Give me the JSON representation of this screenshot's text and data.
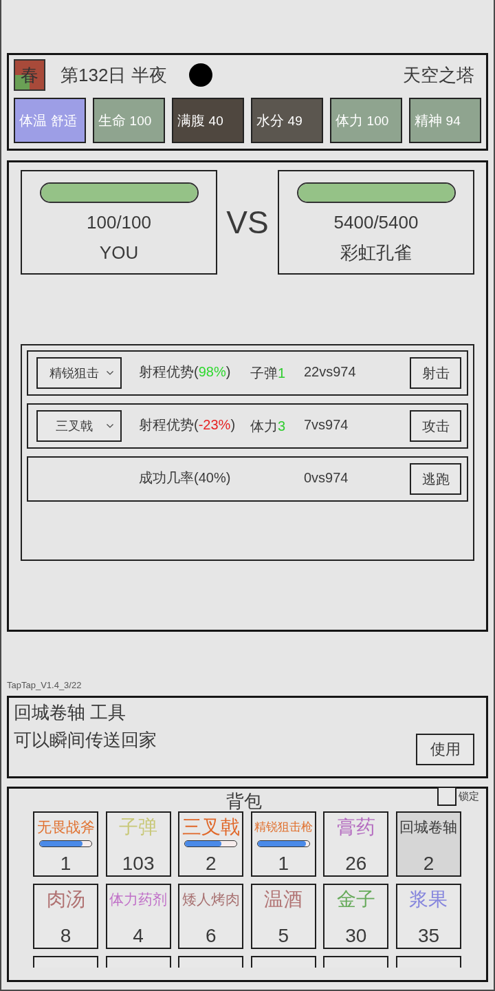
{
  "header": {
    "season": "春",
    "day": "第132日 半夜",
    "night": true,
    "location": "天空之塔",
    "stats": [
      {
        "label": "体温",
        "value": "舒适",
        "color": "#9d9ee6"
      },
      {
        "label": "生命",
        "value": "100",
        "color": "#8fa48f"
      },
      {
        "label": "满腹",
        "value": "40",
        "color": "#4f473f"
      },
      {
        "label": "水分",
        "value": "49",
        "color": "#5b564f"
      },
      {
        "label": "体力",
        "value": "100",
        "color": "#8fa48f"
      },
      {
        "label": "精神",
        "value": "94",
        "color": "#8fa48f"
      }
    ]
  },
  "battle": {
    "fighters": [
      {
        "hp": "100/100",
        "name": "YOU",
        "level": 1
      },
      {
        "hp": "5400/5400",
        "name": "彩虹孔雀",
        "level": 1
      }
    ],
    "versus": "VS",
    "actions": [
      {
        "kind": "weapon",
        "weapon": "精锐狙击",
        "stat": {
          "prefix": "射程优势(",
          "value": "98%",
          "suffix": ")",
          "color": "#2ed82e"
        },
        "cost_label": "子弹",
        "cost_value": "1",
        "power": "22vs974",
        "button": "射击"
      },
      {
        "kind": "weapon",
        "weapon": "三叉戟",
        "stat": {
          "prefix": "射程优势(",
          "value": "-23%",
          "suffix": ")",
          "color": "#e62222"
        },
        "cost_label": "体力",
        "cost_value": "3",
        "power": "7vs974",
        "button": "攻击"
      },
      {
        "kind": "flee",
        "stat": {
          "prefix": "成功几率(",
          "value": "40%",
          "suffix": ")",
          "color": "#3a3a3a"
        },
        "power": "0vs974",
        "button": "逃跑"
      }
    ]
  },
  "version": "TapTap_V1.4_3/22",
  "detail": {
    "title": "回城卷轴 工具",
    "description": "可以瞬间传送回家",
    "button": "使用"
  },
  "inventory": {
    "title": "背包",
    "lock": {
      "label": "锁定",
      "checked": false
    },
    "items": [
      {
        "kind": "item",
        "name": "无畏战斧",
        "count": "1",
        "color": "#e0702e",
        "level": 0.83,
        "selected": false
      },
      {
        "kind": "item",
        "name": "子弹",
        "count": "103",
        "color": "#c8c878",
        "selected": false
      },
      {
        "kind": "item",
        "name": "三叉戟",
        "count": "2",
        "color": "#e0682a",
        "level": 0.7,
        "selected": false
      },
      {
        "kind": "item",
        "name": "精锐狙击枪",
        "count": "1",
        "color": "#e0702e",
        "level": 0.93,
        "selected": false
      },
      {
        "kind": "item",
        "name": "膏药",
        "count": "26",
        "color": "#b46cc0",
        "selected": false
      },
      {
        "kind": "item",
        "name": "回城卷轴",
        "count": "2",
        "color": "#3a3a3a",
        "selected": true
      },
      {
        "kind": "item",
        "name": "肉汤",
        "count": "8",
        "color": "#b07272",
        "selected": false
      },
      {
        "kind": "item",
        "name": "体力药剂",
        "count": "4",
        "color": "#c070c8",
        "selected": false
      },
      {
        "kind": "item",
        "name": "矮人烤肉",
        "count": "6",
        "color": "#a87272",
        "selected": false
      },
      {
        "kind": "item",
        "name": "温酒",
        "count": "5",
        "color": "#b07272",
        "selected": false
      },
      {
        "kind": "item",
        "name": "金子",
        "count": "30",
        "color": "#66aa5a",
        "selected": false
      },
      {
        "kind": "item",
        "name": "浆果",
        "count": "35",
        "color": "#8585dd",
        "selected": false
      },
      {
        "kind": "clipped",
        "selected": false
      },
      {
        "kind": "clipped",
        "selected": false
      },
      {
        "kind": "clipped",
        "selected": false
      },
      {
        "kind": "clipped",
        "selected": false
      },
      {
        "kind": "clipped",
        "selected": false
      },
      {
        "kind": "clipped",
        "selected": false
      }
    ]
  }
}
